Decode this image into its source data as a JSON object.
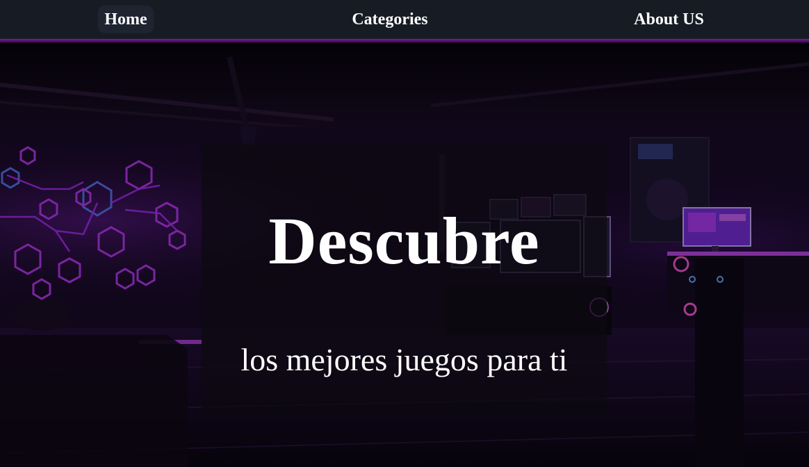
{
  "nav": {
    "items": [
      {
        "label": "Home",
        "active": true
      },
      {
        "label": "Categories",
        "active": false
      },
      {
        "label": "About US",
        "active": false
      }
    ]
  },
  "hero": {
    "title": "Descubre",
    "subtitle": "los mejores juegos para ti"
  },
  "colors": {
    "nav_background": "#171c24",
    "nav_accent": "#7a1e9a",
    "neon_purple": "#b030ff",
    "text": "#ffffff"
  }
}
